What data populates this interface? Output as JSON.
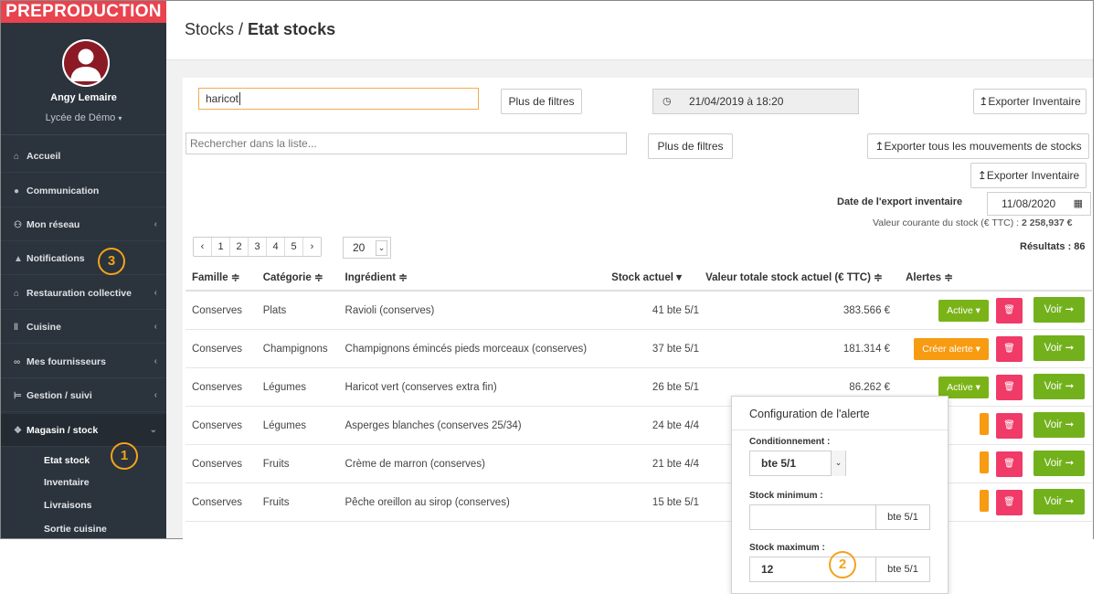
{
  "environment": "PREPRODUCTION",
  "user": {
    "name": "Angy Lemaire",
    "org": "Lycée de Démo"
  },
  "nav": [
    {
      "label": "Accueil",
      "icon": "home-icon"
    },
    {
      "label": "Communication",
      "icon": "chat-icon"
    },
    {
      "label": "Mon réseau",
      "icon": "network-icon"
    },
    {
      "label": "Notifications",
      "icon": "bell-icon"
    },
    {
      "label": "Restauration collective",
      "icon": "institution-icon"
    },
    {
      "label": "Cuisine",
      "icon": "cutlery-icon"
    },
    {
      "label": "Mes fournisseurs",
      "icon": "handshake-icon"
    },
    {
      "label": "Gestion / suivi",
      "icon": "cart-icon"
    },
    {
      "label": "Magasin / stock",
      "icon": "boxes-icon"
    }
  ],
  "subnav": [
    "Etat stock",
    "Inventaire",
    "Livraisons",
    "Sortie cuisine"
  ],
  "breadcrumb": {
    "parent": "Stocks /",
    "current": "Etat stocks"
  },
  "search_filter": {
    "value": "haricot",
    "more_filters": "Plus de filtres"
  },
  "date_display": "21/04/2019 à 18:20",
  "export_inventaire": "Exporter Inventaire",
  "list_search": {
    "placeholder": "Rechercher dans la liste...",
    "more_filters": "Plus de filtres"
  },
  "export_all_movements": "Exporter tous les mouvements de stocks",
  "export_inventaire_2": "Exporter Inventaire",
  "export_date": {
    "label": "Date de l'export inventaire",
    "value": "11/08/2020"
  },
  "stock_value": {
    "label": "Valeur courante du stock (€ TTC) :",
    "value": "2 258,937 €"
  },
  "results": "Résultats : 86",
  "pagination": {
    "prev": "‹",
    "pages": [
      "1",
      "2",
      "3",
      "4",
      "5"
    ],
    "next": "›",
    "page_size": "20"
  },
  "table": {
    "headers": [
      "Famille ≑",
      "Catégorie ≑",
      "Ingrédient ≑",
      "Stock actuel ▾",
      "Valeur totale stock actuel (€ TTC) ≑",
      "Alertes ≑"
    ],
    "rows": [
      {
        "famille": "Conserves",
        "categorie": "Plats",
        "ingredient": "Ravioli (conserves)",
        "stock": "41 bte 5/1",
        "valeur": "383.566 €",
        "alerte": "Active ▾",
        "alerte_type": "active"
      },
      {
        "famille": "Conserves",
        "categorie": "Champignons",
        "ingredient": "Champignons émincés pieds morceaux (conserves)",
        "stock": "37 bte 5/1",
        "valeur": "181.314 €",
        "alerte": "Créer alerte ▾",
        "alerte_type": "create"
      },
      {
        "famille": "Conserves",
        "categorie": "Légumes",
        "ingredient": "Haricot vert (conserves extra fin)",
        "stock": "26 bte 5/1",
        "valeur": "86.262 €",
        "alerte": "Active ▾",
        "alerte_type": "active"
      },
      {
        "famille": "Conserves",
        "categorie": "Légumes",
        "ingredient": "Asperges blanches (conserves 25/34)",
        "stock": "24 bte 4/4",
        "valeur": "",
        "alerte": "",
        "alerte_type": "hidden"
      },
      {
        "famille": "Conserves",
        "categorie": "Fruits",
        "ingredient": "Crème de marron (conserves)",
        "stock": "21 bte 4/4",
        "valeur": "",
        "alerte": "",
        "alerte_type": "hidden"
      },
      {
        "famille": "Conserves",
        "categorie": "Fruits",
        "ingredient": "Pêche oreillon au sirop (conserves)",
        "stock": "15 bte 5/1",
        "valeur": "",
        "alerte": "",
        "alerte_type": "hidden"
      }
    ],
    "voir_label": "Voir ➞"
  },
  "alert_popup": {
    "title": "Configuration de l'alerte",
    "conditionnement_label": "Conditionnement :",
    "conditionnement_value": "bte 5/1",
    "stock_min_label": "Stock minimum :",
    "stock_min_value": "",
    "stock_max_label": "Stock maximum :",
    "stock_max_value": "12",
    "unit": "bte 5/1"
  },
  "callouts": [
    "1",
    "2",
    "3"
  ],
  "colors": {
    "brand_red": "#e8434e",
    "sidebar": "#2b333c",
    "green": "#72b11c",
    "orange": "#f79b12",
    "pink": "#f03a67",
    "callout": "#f2a31b"
  }
}
